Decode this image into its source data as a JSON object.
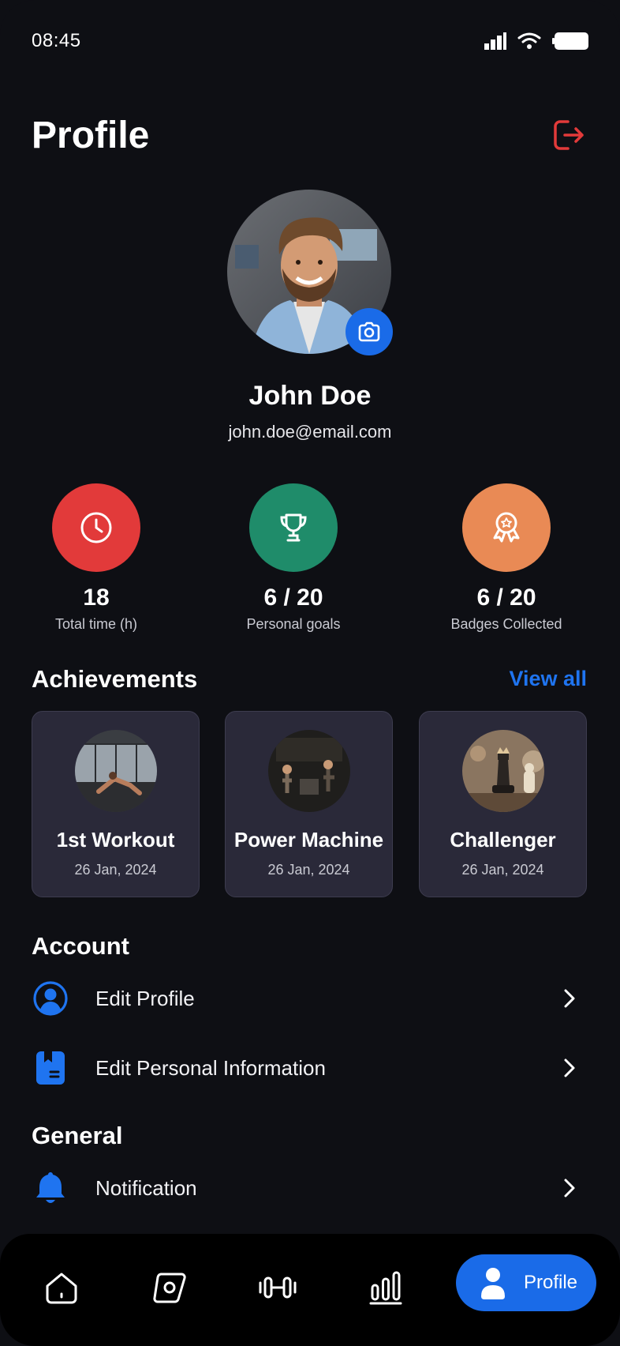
{
  "status_bar": {
    "time": "08:45"
  },
  "header": {
    "title": "Profile"
  },
  "user": {
    "name": "John Doe",
    "email": "john.doe@email.com"
  },
  "stats": [
    {
      "value": "18",
      "label": "Total time (h)",
      "color": "#e23a3a",
      "icon": "clock-icon"
    },
    {
      "value": "6 / 20",
      "label": "Personal goals",
      "color": "#1f8c6a",
      "icon": "trophy-icon"
    },
    {
      "value": "6 / 20",
      "label": "Badges Collected",
      "color": "#e98a55",
      "icon": "badge-icon"
    }
  ],
  "achievements": {
    "title": "Achievements",
    "view_all": "View all",
    "items": [
      {
        "title": "1st Workout",
        "date": "26 Jan, 2024"
      },
      {
        "title": "Power Machine",
        "date": "26 Jan, 2024"
      },
      {
        "title": "Challenger",
        "date": "26 Jan, 2024"
      }
    ]
  },
  "account": {
    "title": "Account",
    "items": [
      {
        "label": "Edit Profile",
        "icon": "user-circle-icon"
      },
      {
        "label": "Edit Personal Information",
        "icon": "document-icon"
      }
    ]
  },
  "general": {
    "title": "General",
    "items": [
      {
        "label": "Notification",
        "icon": "bell-icon"
      }
    ]
  },
  "bottom_nav": {
    "items": [
      "home-icon",
      "compass-icon",
      "dumbbell-icon",
      "chart-icon"
    ],
    "active_label": "Profile"
  },
  "colors": {
    "accent": "#1a6be8",
    "logout": "#e23a3a",
    "background": "#0e0f14",
    "card": "#2a2939"
  }
}
